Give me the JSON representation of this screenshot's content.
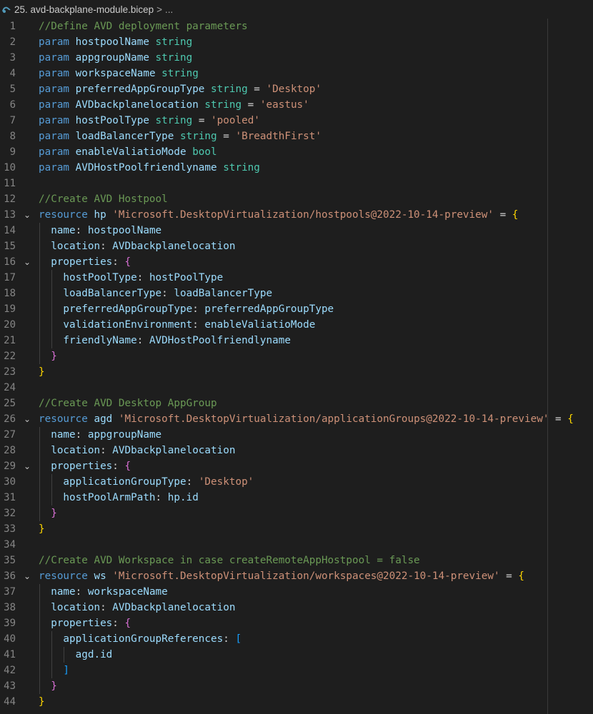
{
  "breadcrumb": {
    "icon": "bicep-file-icon",
    "file": "25. avd-backplane-module.bicep",
    "separator": ">",
    "trail": "..."
  },
  "editor": {
    "lines": [
      {
        "n": "1",
        "fold": "",
        "tokens": [
          {
            "t": "//Define AVD deployment parameters",
            "c": "cm"
          }
        ]
      },
      {
        "n": "2",
        "fold": "",
        "tokens": [
          {
            "t": "param ",
            "c": "kw"
          },
          {
            "t": "hostpoolName",
            "c": "id"
          },
          {
            "t": " string",
            "c": "ty"
          }
        ]
      },
      {
        "n": "3",
        "fold": "",
        "tokens": [
          {
            "t": "param ",
            "c": "kw"
          },
          {
            "t": "appgroupName",
            "c": "id"
          },
          {
            "t": " string",
            "c": "ty"
          }
        ]
      },
      {
        "n": "4",
        "fold": "",
        "tokens": [
          {
            "t": "param ",
            "c": "kw"
          },
          {
            "t": "workspaceName",
            "c": "id"
          },
          {
            "t": " string",
            "c": "ty"
          }
        ]
      },
      {
        "n": "5",
        "fold": "",
        "tokens": [
          {
            "t": "param ",
            "c": "kw"
          },
          {
            "t": "preferredAppGroupType",
            "c": "id"
          },
          {
            "t": " string",
            "c": "ty"
          },
          {
            "t": " = ",
            "c": "op"
          },
          {
            "t": "'Desktop'",
            "c": "str"
          }
        ]
      },
      {
        "n": "6",
        "fold": "",
        "tokens": [
          {
            "t": "param ",
            "c": "kw"
          },
          {
            "t": "AVDbackplanelocation",
            "c": "id"
          },
          {
            "t": " string",
            "c": "ty"
          },
          {
            "t": " = ",
            "c": "op"
          },
          {
            "t": "'eastus'",
            "c": "str"
          }
        ]
      },
      {
        "n": "7",
        "fold": "",
        "tokens": [
          {
            "t": "param ",
            "c": "kw"
          },
          {
            "t": "hostPoolType",
            "c": "id"
          },
          {
            "t": " string",
            "c": "ty"
          },
          {
            "t": " = ",
            "c": "op"
          },
          {
            "t": "'pooled'",
            "c": "str"
          }
        ]
      },
      {
        "n": "8",
        "fold": "",
        "tokens": [
          {
            "t": "param ",
            "c": "kw"
          },
          {
            "t": "loadBalancerType",
            "c": "id"
          },
          {
            "t": " string",
            "c": "ty"
          },
          {
            "t": " = ",
            "c": "op"
          },
          {
            "t": "'BreadthFirst'",
            "c": "str"
          }
        ]
      },
      {
        "n": "9",
        "fold": "",
        "tokens": [
          {
            "t": "param ",
            "c": "kw"
          },
          {
            "t": "enableValiatioMode",
            "c": "id"
          },
          {
            "t": " bool",
            "c": "ty"
          }
        ]
      },
      {
        "n": "10",
        "fold": "",
        "tokens": [
          {
            "t": "param ",
            "c": "kw"
          },
          {
            "t": "AVDHostPoolfriendlyname",
            "c": "id"
          },
          {
            "t": " string",
            "c": "ty"
          }
        ]
      },
      {
        "n": "11",
        "fold": "",
        "tokens": []
      },
      {
        "n": "12",
        "fold": "",
        "tokens": [
          {
            "t": "//Create AVD Hostpool",
            "c": "cm"
          }
        ]
      },
      {
        "n": "13",
        "fold": "⌄",
        "tokens": [
          {
            "t": "resource ",
            "c": "kw"
          },
          {
            "t": "hp",
            "c": "id"
          },
          {
            "t": " ",
            "c": "op"
          },
          {
            "t": "'Microsoft.DesktopVirtualization/hostpools@2022-10-14-preview'",
            "c": "str"
          },
          {
            "t": " = ",
            "c": "op"
          },
          {
            "t": "{",
            "c": "br1"
          }
        ]
      },
      {
        "n": "14",
        "fold": "",
        "tokens": [
          {
            "t": "  name",
            "c": "id"
          },
          {
            "t": ": ",
            "c": "op"
          },
          {
            "t": "hostpoolName",
            "c": "id"
          }
        ]
      },
      {
        "n": "15",
        "fold": "",
        "tokens": [
          {
            "t": "  location",
            "c": "id"
          },
          {
            "t": ": ",
            "c": "op"
          },
          {
            "t": "AVDbackplanelocation",
            "c": "id"
          }
        ]
      },
      {
        "n": "16",
        "fold": "⌄",
        "tokens": [
          {
            "t": "  properties",
            "c": "id"
          },
          {
            "t": ": ",
            "c": "op"
          },
          {
            "t": "{",
            "c": "br2"
          }
        ]
      },
      {
        "n": "17",
        "fold": "",
        "tokens": [
          {
            "t": "    hostPoolType",
            "c": "id"
          },
          {
            "t": ": ",
            "c": "op"
          },
          {
            "t": "hostPoolType",
            "c": "id"
          }
        ]
      },
      {
        "n": "18",
        "fold": "",
        "tokens": [
          {
            "t": "    loadBalancerType",
            "c": "id"
          },
          {
            "t": ": ",
            "c": "op"
          },
          {
            "t": "loadBalancerType",
            "c": "id"
          }
        ]
      },
      {
        "n": "19",
        "fold": "",
        "tokens": [
          {
            "t": "    preferredAppGroupType",
            "c": "id"
          },
          {
            "t": ": ",
            "c": "op"
          },
          {
            "t": "preferredAppGroupType",
            "c": "id"
          }
        ]
      },
      {
        "n": "20",
        "fold": "",
        "tokens": [
          {
            "t": "    validationEnvironment",
            "c": "id"
          },
          {
            "t": ": ",
            "c": "op"
          },
          {
            "t": "enableValiatioMode",
            "c": "id"
          }
        ]
      },
      {
        "n": "21",
        "fold": "",
        "tokens": [
          {
            "t": "    friendlyName",
            "c": "id"
          },
          {
            "t": ": ",
            "c": "op"
          },
          {
            "t": "AVDHostPoolfriendlyname",
            "c": "id"
          }
        ]
      },
      {
        "n": "22",
        "fold": "",
        "tokens": [
          {
            "t": "  }",
            "c": "br2"
          }
        ]
      },
      {
        "n": "23",
        "fold": "",
        "tokens": [
          {
            "t": "}",
            "c": "br1"
          }
        ]
      },
      {
        "n": "24",
        "fold": "",
        "tokens": []
      },
      {
        "n": "25",
        "fold": "",
        "tokens": [
          {
            "t": "//Create AVD Desktop AppGroup",
            "c": "cm"
          }
        ]
      },
      {
        "n": "26",
        "fold": "⌄",
        "tokens": [
          {
            "t": "resource ",
            "c": "kw"
          },
          {
            "t": "agd",
            "c": "id"
          },
          {
            "t": " ",
            "c": "op"
          },
          {
            "t": "'Microsoft.DesktopVirtualization/applicationGroups@2022-10-14-preview'",
            "c": "str"
          },
          {
            "t": " = ",
            "c": "op"
          },
          {
            "t": "{",
            "c": "br1"
          }
        ]
      },
      {
        "n": "27",
        "fold": "",
        "tokens": [
          {
            "t": "  name",
            "c": "id"
          },
          {
            "t": ": ",
            "c": "op"
          },
          {
            "t": "appgroupName",
            "c": "id"
          }
        ]
      },
      {
        "n": "28",
        "fold": "",
        "tokens": [
          {
            "t": "  location",
            "c": "id"
          },
          {
            "t": ": ",
            "c": "op"
          },
          {
            "t": "AVDbackplanelocation",
            "c": "id"
          }
        ]
      },
      {
        "n": "29",
        "fold": "⌄",
        "tokens": [
          {
            "t": "  properties",
            "c": "id"
          },
          {
            "t": ": ",
            "c": "op"
          },
          {
            "t": "{",
            "c": "br2"
          }
        ]
      },
      {
        "n": "30",
        "fold": "",
        "tokens": [
          {
            "t": "    applicationGroupType",
            "c": "id"
          },
          {
            "t": ": ",
            "c": "op"
          },
          {
            "t": "'Desktop'",
            "c": "str"
          }
        ]
      },
      {
        "n": "31",
        "fold": "",
        "tokens": [
          {
            "t": "    hostPoolArmPath",
            "c": "id"
          },
          {
            "t": ": ",
            "c": "op"
          },
          {
            "t": "hp.id",
            "c": "id"
          }
        ]
      },
      {
        "n": "32",
        "fold": "",
        "tokens": [
          {
            "t": "  }",
            "c": "br2"
          }
        ]
      },
      {
        "n": "33",
        "fold": "",
        "tokens": [
          {
            "t": "}",
            "c": "br1"
          }
        ]
      },
      {
        "n": "34",
        "fold": "",
        "tokens": []
      },
      {
        "n": "35",
        "fold": "",
        "tokens": [
          {
            "t": "//Create AVD Workspace in case createRemoteAppHostpool = false",
            "c": "cm"
          }
        ]
      },
      {
        "n": "36",
        "fold": "⌄",
        "tokens": [
          {
            "t": "resource ",
            "c": "kw"
          },
          {
            "t": "ws",
            "c": "id"
          },
          {
            "t": " ",
            "c": "op"
          },
          {
            "t": "'Microsoft.DesktopVirtualization/workspaces@2022-10-14-preview'",
            "c": "str"
          },
          {
            "t": " = ",
            "c": "op"
          },
          {
            "t": "{",
            "c": "br1"
          }
        ]
      },
      {
        "n": "37",
        "fold": "",
        "tokens": [
          {
            "t": "  name",
            "c": "id"
          },
          {
            "t": ": ",
            "c": "op"
          },
          {
            "t": "workspaceName",
            "c": "id"
          }
        ]
      },
      {
        "n": "38",
        "fold": "",
        "tokens": [
          {
            "t": "  location",
            "c": "id"
          },
          {
            "t": ": ",
            "c": "op"
          },
          {
            "t": "AVDbackplanelocation",
            "c": "id"
          }
        ]
      },
      {
        "n": "39",
        "fold": "",
        "tokens": [
          {
            "t": "  properties",
            "c": "id"
          },
          {
            "t": ": ",
            "c": "op"
          },
          {
            "t": "{",
            "c": "br2"
          }
        ]
      },
      {
        "n": "40",
        "fold": "",
        "tokens": [
          {
            "t": "    applicationGroupReferences",
            "c": "id"
          },
          {
            "t": ": ",
            "c": "op"
          },
          {
            "t": "[",
            "c": "br3"
          }
        ]
      },
      {
        "n": "41",
        "fold": "",
        "tokens": [
          {
            "t": "      agd.id",
            "c": "id"
          }
        ]
      },
      {
        "n": "42",
        "fold": "",
        "tokens": [
          {
            "t": "    ]",
            "c": "br3"
          }
        ]
      },
      {
        "n": "43",
        "fold": "",
        "tokens": [
          {
            "t": "  }",
            "c": "br2"
          }
        ]
      },
      {
        "n": "44",
        "fold": "",
        "tokens": [
          {
            "t": "}",
            "c": "br1"
          }
        ]
      }
    ]
  }
}
